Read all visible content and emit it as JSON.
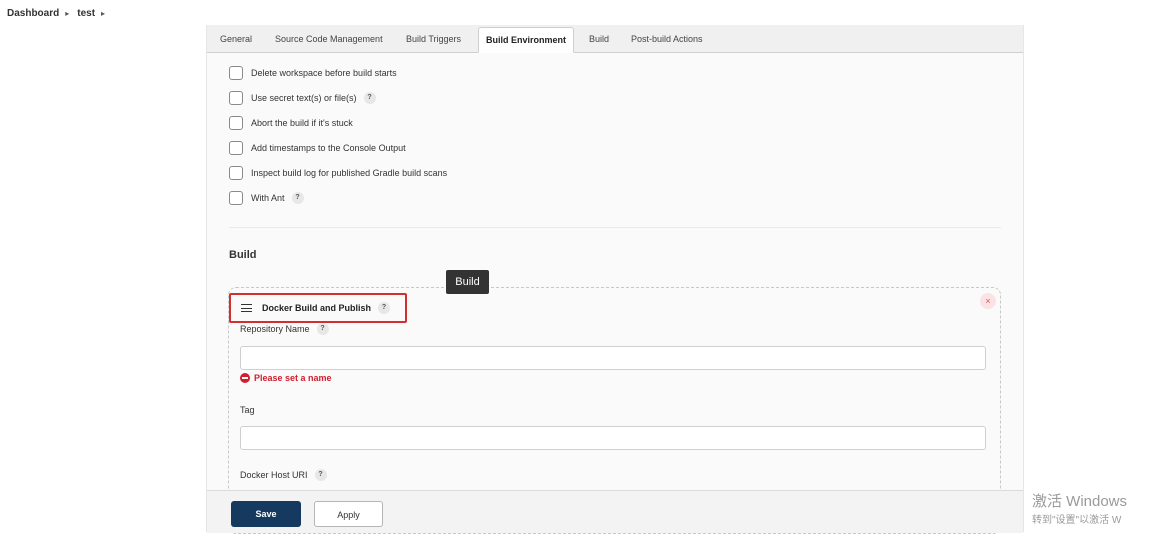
{
  "breadcrumb": {
    "items": [
      "Dashboard",
      "test"
    ],
    "separator": "▸"
  },
  "tabs": [
    "General",
    "Source Code Management",
    "Build Triggers",
    "Build Environment",
    "Build",
    "Post-build Actions"
  ],
  "active_tab": "Build Environment",
  "build_environment": {
    "options": [
      {
        "label": "Delete workspace before build starts",
        "checked": false,
        "help": false
      },
      {
        "label": "Use secret text(s) or file(s)",
        "checked": false,
        "help": true
      },
      {
        "label": "Abort the build if it's stuck",
        "checked": false,
        "help": false
      },
      {
        "label": "Add timestamps to the Console Output",
        "checked": false,
        "help": false
      },
      {
        "label": "Inspect build log for published Gradle build scans",
        "checked": false,
        "help": false
      },
      {
        "label": "With Ant",
        "checked": false,
        "help": true
      }
    ]
  },
  "build_section": {
    "title": "Build",
    "tooltip": "Build",
    "step": {
      "title": "Docker Build and Publish",
      "close_symbol": "×",
      "fields": {
        "repository_name": {
          "label": "Repository Name",
          "value": "",
          "error": "Please set a name"
        },
        "tag": {
          "label": "Tag",
          "value": ""
        },
        "docker_host_uri": {
          "label": "Docker Host URI"
        }
      }
    }
  },
  "help_symbol": "?",
  "buttons": {
    "save": "Save",
    "apply": "Apply"
  },
  "watermark": {
    "line1": "激活 Windows",
    "line2": "转到\"设置\"以激活 W"
  },
  "colors": {
    "save_button": "#163a5f",
    "error": "#d11f2f",
    "highlight_box": "#d32f2f",
    "tooltip_bg": "#333333"
  }
}
